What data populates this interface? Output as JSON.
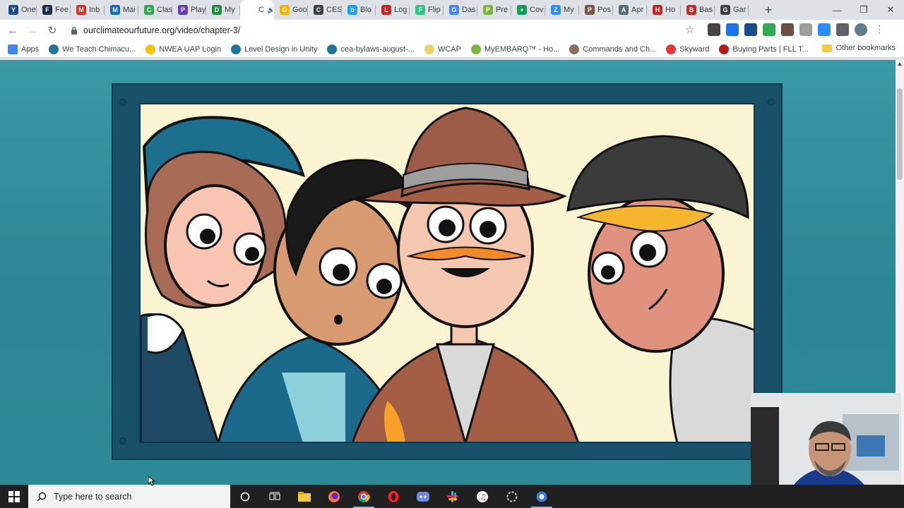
{
  "browser": {
    "tabs": [
      {
        "label": "One",
        "color": "#1a4b8c",
        "glyph": "Y"
      },
      {
        "label": "Fee",
        "color": "#1b2a4a",
        "glyph": "F"
      },
      {
        "label": "Inb",
        "color": "#d93025",
        "glyph": "M"
      },
      {
        "label": "Mai",
        "color": "#0f6cbd",
        "glyph": "M"
      },
      {
        "label": "Clas",
        "color": "#34a853",
        "glyph": "C"
      },
      {
        "label": "Play",
        "color": "#673ab7",
        "glyph": "P"
      },
      {
        "label": "My",
        "color": "#1e8e3e",
        "glyph": "D"
      },
      {
        "label": "C",
        "color": "#ffffff",
        "glyph": ""
      },
      {
        "label": "Goo",
        "color": "#f4b400",
        "glyph": "G"
      },
      {
        "label": "CES",
        "color": "#3c4043",
        "glyph": "C"
      },
      {
        "label": "Blo",
        "color": "#1da1f2",
        "glyph": "b"
      },
      {
        "label": "Log",
        "color": "#c62828",
        "glyph": "L"
      },
      {
        "label": "Flip",
        "color": "#31c48d",
        "glyph": "F"
      },
      {
        "label": "Das",
        "color": "#4285f4",
        "glyph": "G"
      },
      {
        "label": "Pre",
        "color": "#7cb342",
        "glyph": "P"
      },
      {
        "label": "Cov",
        "color": "#0f9d58",
        "glyph": "+"
      },
      {
        "label": "My",
        "color": "#2d8cff",
        "glyph": "Z"
      },
      {
        "label": "Pos",
        "color": "#795548",
        "glyph": "P"
      },
      {
        "label": "Apr",
        "color": "#546e7a",
        "glyph": "A"
      },
      {
        "label": "Ho",
        "color": "#c62828",
        "glyph": "H"
      },
      {
        "label": "Bas",
        "color": "#c62828",
        "glyph": "B"
      },
      {
        "label": "Gar",
        "color": "#3c4043",
        "glyph": "G"
      }
    ],
    "url": "ourclimateourfuture.org/video/chapter-3/",
    "bookmarks": [
      {
        "label": "Apps",
        "color": "#4285f4"
      },
      {
        "label": "We Teach Chimacu...",
        "color": "#21759b"
      },
      {
        "label": "NWEA UAP Login",
        "color": "#f4c20d"
      },
      {
        "label": "Level Design in Unity",
        "color": "#21759b"
      },
      {
        "label": "cea-bylaws-august-...",
        "color": "#21759b"
      },
      {
        "label": "WCAP",
        "color": "#e6d36b"
      },
      {
        "label": "MyEMBARQ™ - Ho...",
        "color": "#7cb342"
      },
      {
        "label": "Commands and Ch...",
        "color": "#8d6e63"
      },
      {
        "label": "Skyward",
        "color": "#e53935"
      },
      {
        "label": "Buying Parts | FLL T...",
        "color": "#b71c1c"
      }
    ],
    "other_bookmarks": "Other bookmarks"
  },
  "taskbar": {
    "search_placeholder": "Type here to search"
  }
}
